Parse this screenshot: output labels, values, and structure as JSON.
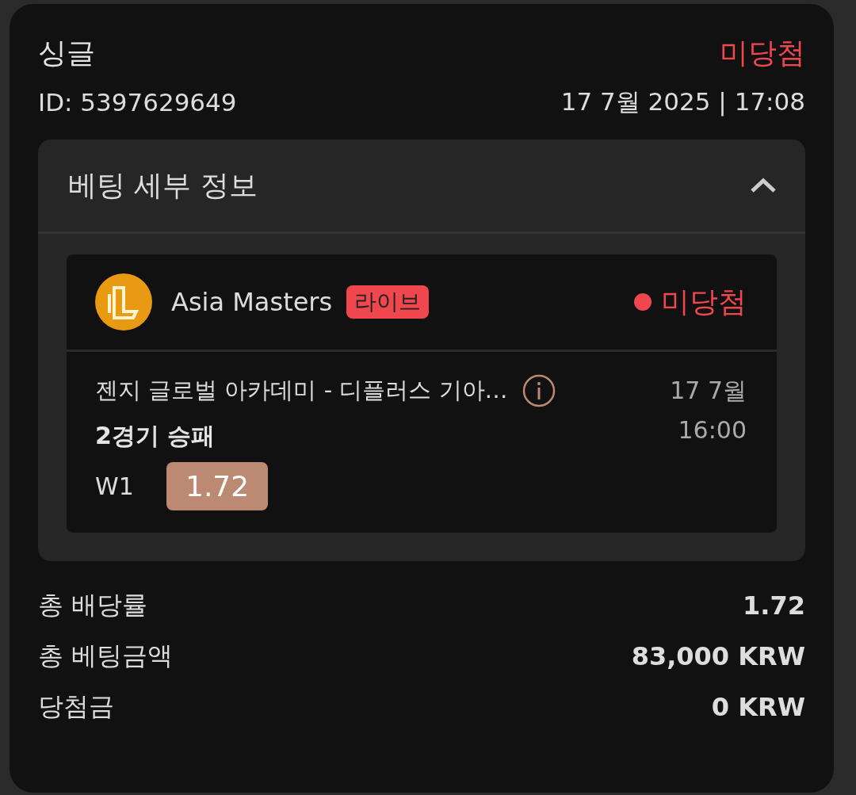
{
  "bet": {
    "type": "싱글",
    "status": {
      "text": "미당첨",
      "kind": "lost"
    },
    "id": "ID: 5397629649",
    "datetime": "17 7월 2025 | 17:08"
  },
  "details": {
    "title": "베팅 세부 정보",
    "expanded": true,
    "event": {
      "league": "Asia Masters",
      "badge": "라이브",
      "status": {
        "text": "미당첨",
        "kind": "lost"
      },
      "match": "젠지 글로벌 아카데미 - 디플러스 기아…",
      "market": "2경기 승패",
      "date": "17 7월",
      "time": "16:00",
      "selection": "W1",
      "odds": "1.72"
    }
  },
  "summary": [
    {
      "label": "총 배당률",
      "value": "1.72"
    },
    {
      "label": "총 베팅금액",
      "value": "83,000 KRW"
    },
    {
      "label": "당첨금",
      "value": "0 KRW"
    }
  ]
}
